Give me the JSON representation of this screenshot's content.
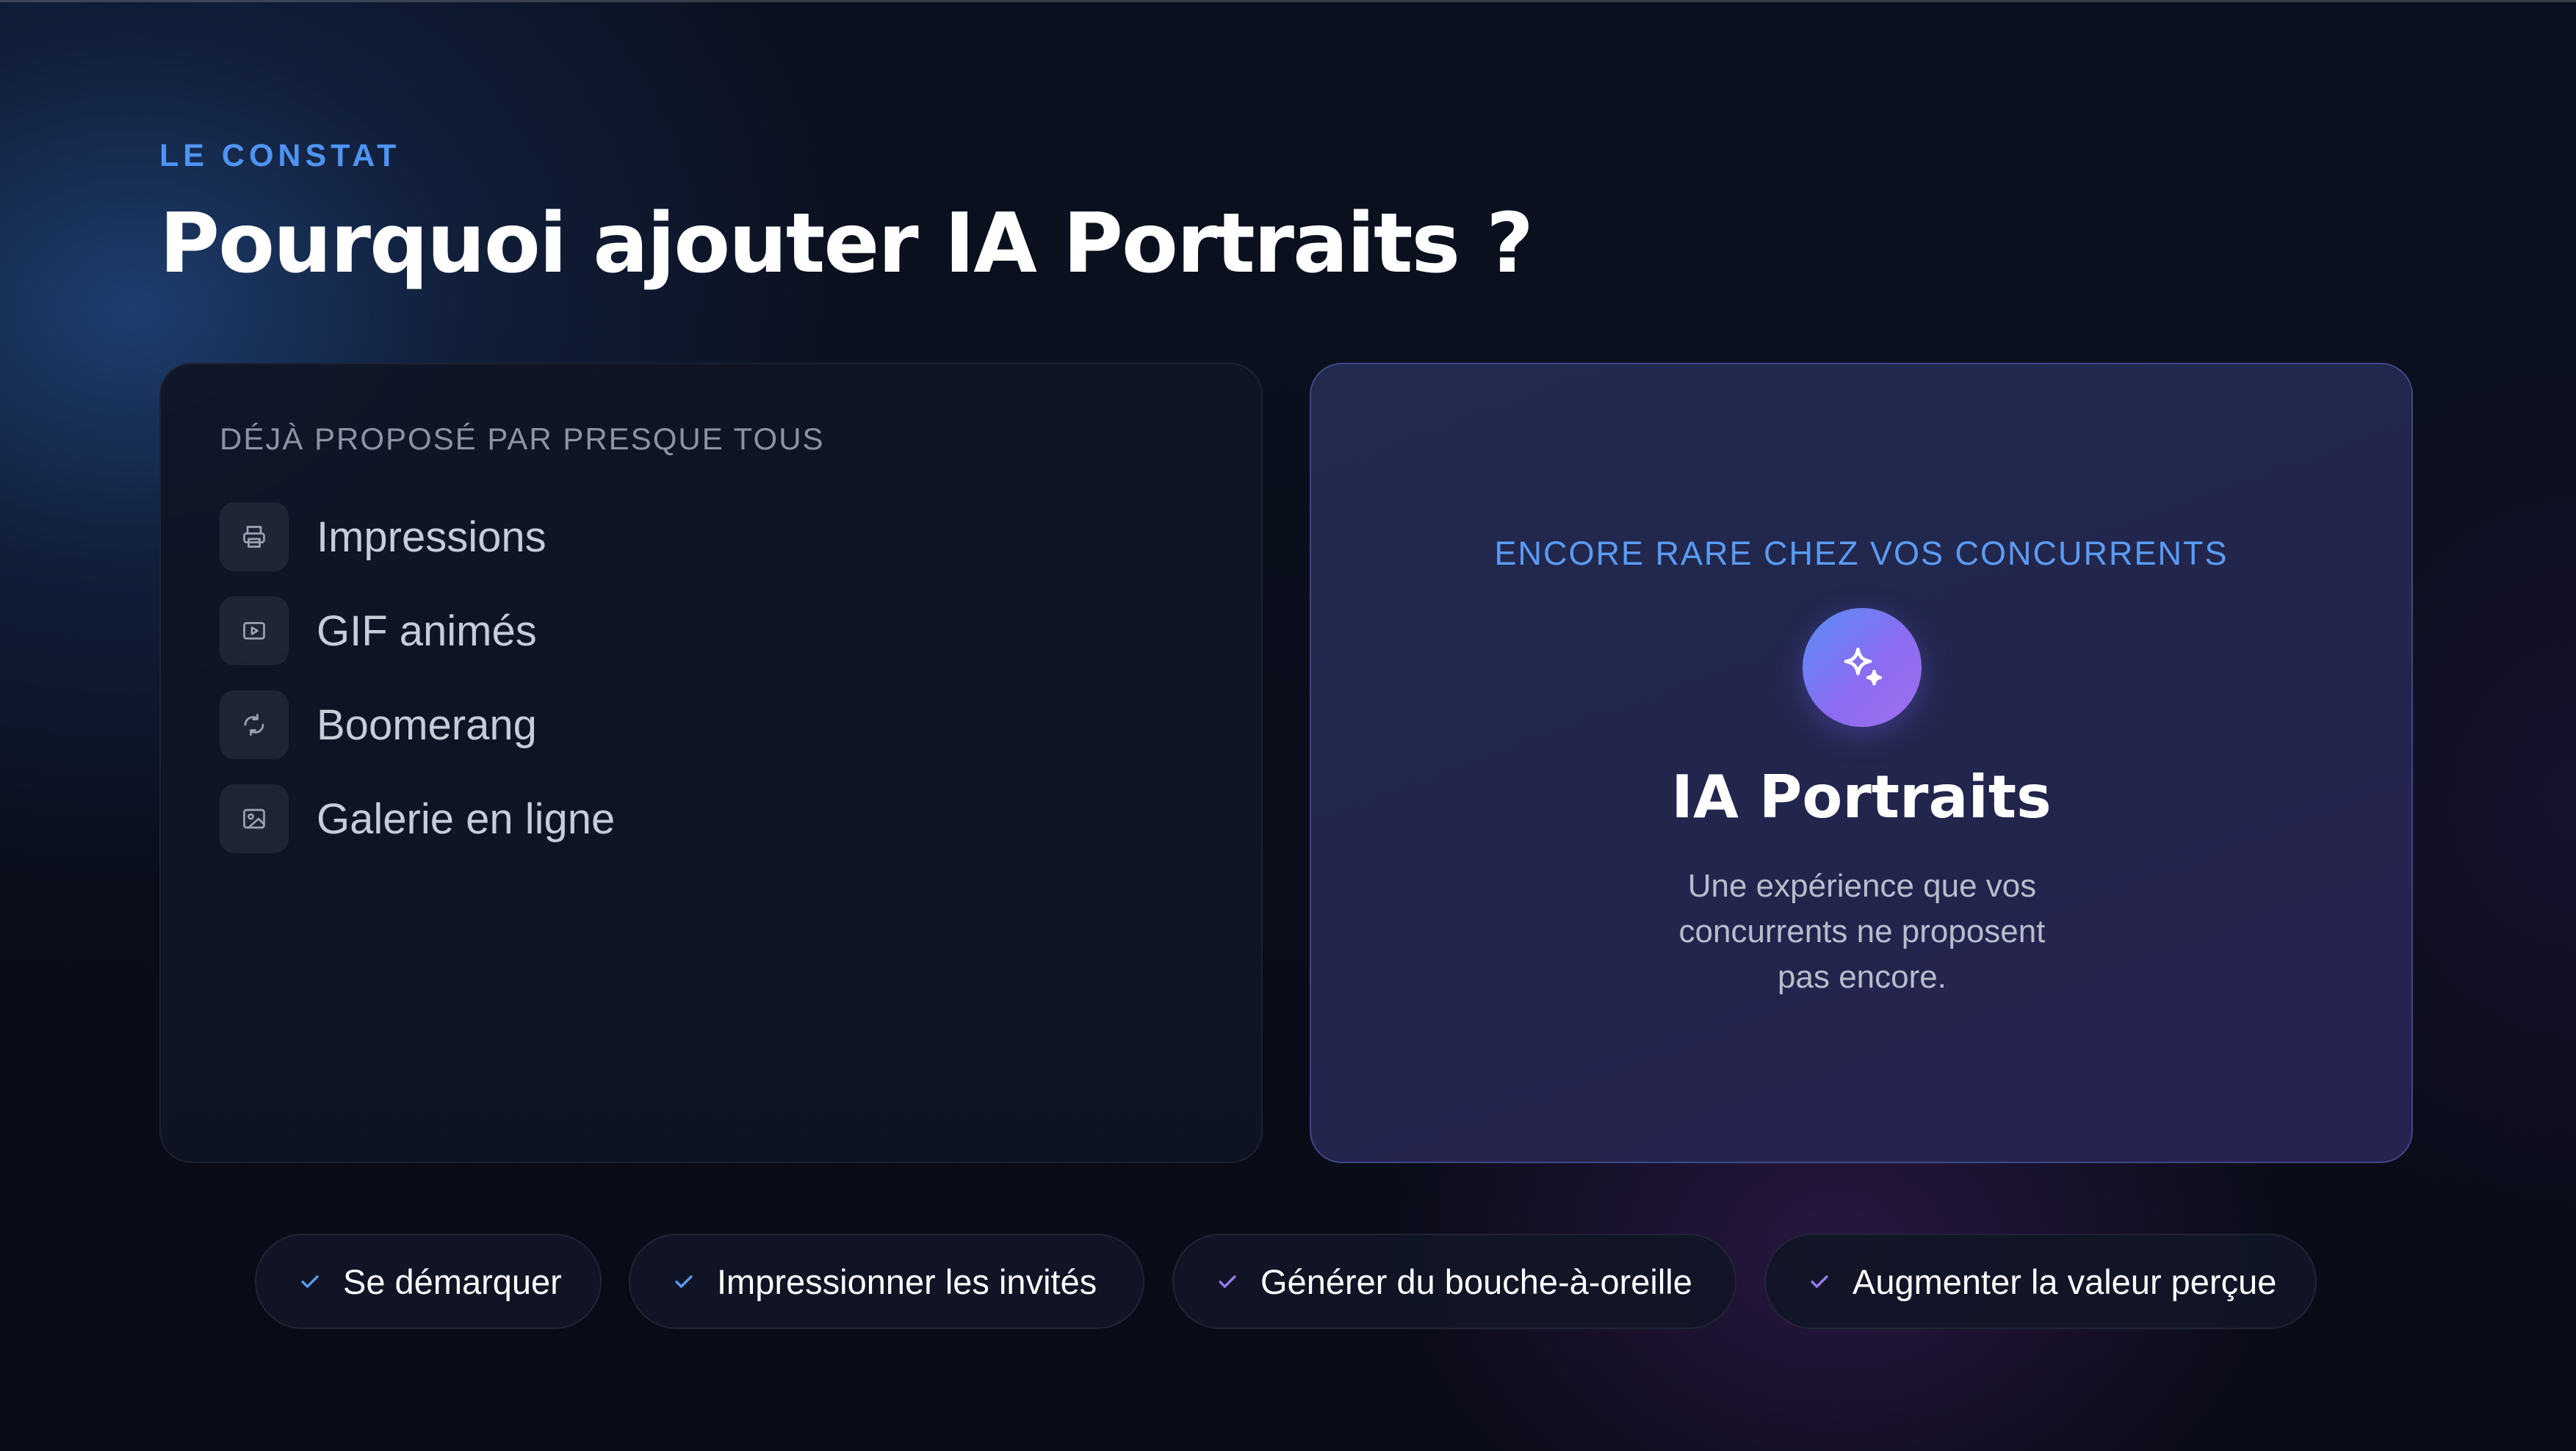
{
  "header": {
    "eyebrow": "LE CONSTAT",
    "title": "Pourquoi ajouter IA Portraits ?"
  },
  "left_card": {
    "heading": "DÉJÀ PROPOSÉ PAR PRESQUE TOUS",
    "items": [
      {
        "label": "Impressions",
        "icon": "printer-icon"
      },
      {
        "label": "GIF animés",
        "icon": "play-icon"
      },
      {
        "label": "Boomerang",
        "icon": "loop-icon"
      },
      {
        "label": "Galerie en ligne",
        "icon": "image-icon"
      }
    ]
  },
  "right_card": {
    "heading": "ENCORE RARE CHEZ VOS CONCURRENTS",
    "icon": "sparkles-icon",
    "title": "IA Portraits",
    "description_lines": [
      "Une expérience que vos",
      "concurrents ne proposent",
      "pas encore."
    ]
  },
  "benefits": [
    {
      "label": "Se démarquer",
      "check_color": "#5b9bf4"
    },
    {
      "label": "Impressionner les invités",
      "check_color": "#5b9bf4"
    },
    {
      "label": "Générer du bouche-à-oreille",
      "check_color": "#9a7bf0"
    },
    {
      "label": "Augmenter la valeur perçue",
      "check_color": "#9a7bf0"
    }
  ],
  "colors": {
    "accent_blue": "#4f94f2",
    "accent_purple": "#9a7bf0",
    "background": "#090b16"
  }
}
